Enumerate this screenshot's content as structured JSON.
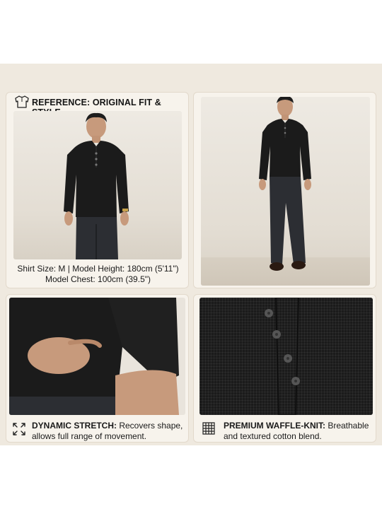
{
  "reference": {
    "icon": "shirt-icon",
    "title": "REFERENCE: ORIGINAL FIT & STYLE",
    "size_line": "Shirt Size: M | Model Height: 180cm (5'11\")",
    "chest_line": "Model Chest: 100cm (39.5\")"
  },
  "features": {
    "stretch": {
      "icon": "expand-arrows-icon",
      "heading": "DYNAMIC STRETCH:",
      "text_1": "Recovers shape,",
      "text_2": "allows full range of movement."
    },
    "knit": {
      "icon": "waffle-grid-icon",
      "heading": "PREMIUM WAFFLE-KNIT:",
      "text_1": "Breathable",
      "text_2": "and textured cotton blend."
    }
  },
  "colors": {
    "background": "#efe9df",
    "panel": "#f7f3ec",
    "garment": "#1b1b1b"
  }
}
